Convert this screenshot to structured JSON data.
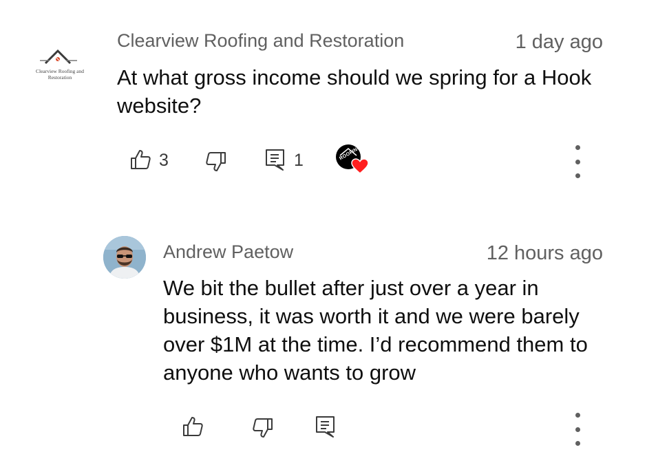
{
  "comments": [
    {
      "author": "Clearview Roofing and Restoration",
      "logo_text": "Clearview Roofing and Restoration",
      "time": "1 day ago",
      "text": "At what gross income should we spring for a Hook website?",
      "likes": "3",
      "replies": "1",
      "heart_badge_text": "ROOFING"
    },
    {
      "author": "Andrew Paetow",
      "time": "12 hours ago",
      "text": "We bit the bullet after just over a year in business, it was worth it and we were barely over $1M at the time. I’d recommend them to anyone who wants to grow"
    }
  ],
  "colors": {
    "text": "#0f0f0f",
    "secondary": "#606060",
    "heart": "#ff1f1f",
    "badge": "#000000"
  },
  "icons": [
    "like-icon",
    "dislike-icon",
    "reply-icon",
    "more-vert-icon",
    "creator-heart-icon"
  ]
}
